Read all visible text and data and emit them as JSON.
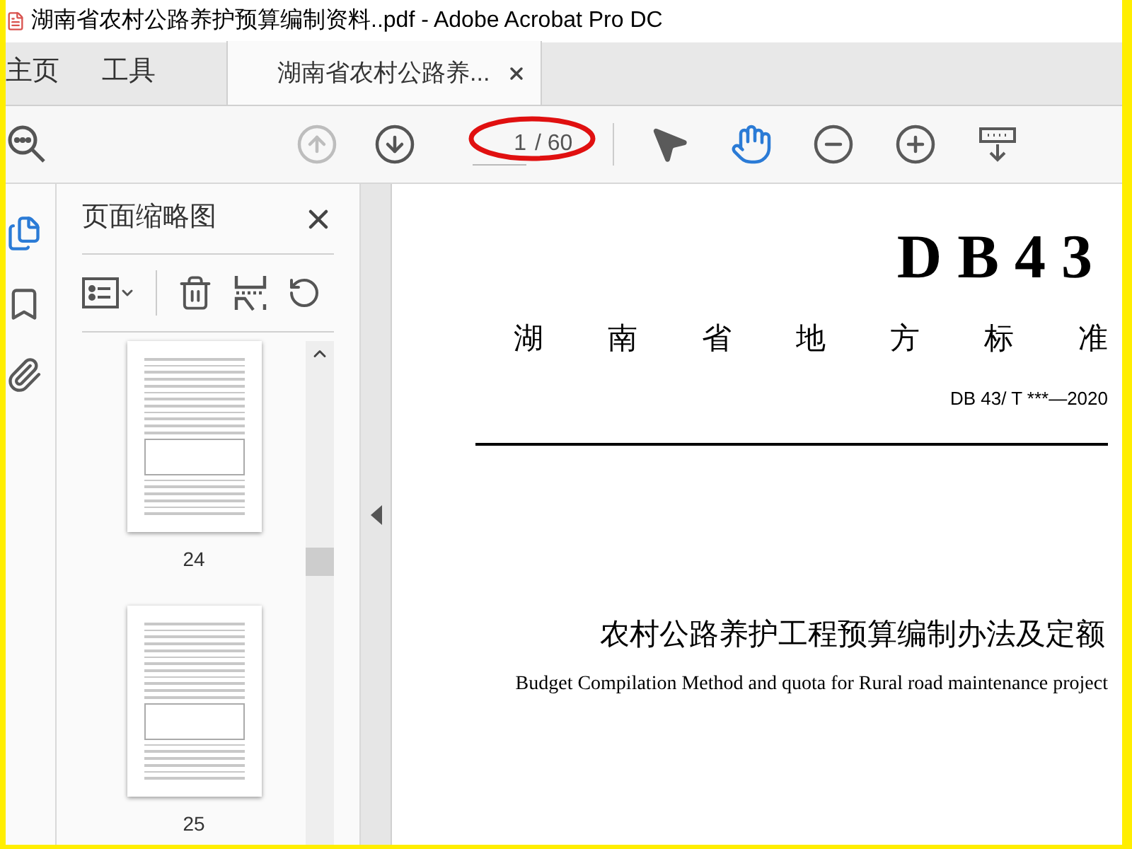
{
  "window": {
    "title": "湖南省农村公路养护预算编制资料..pdf - Adobe Acrobat Pro DC"
  },
  "tabs": [
    {
      "label": "主页",
      "selected": false
    },
    {
      "label": "工具",
      "selected": false
    },
    {
      "label": "湖南省农村公路养...",
      "selected": true
    }
  ],
  "toolbar": {
    "page_up": {
      "disabled": true
    },
    "page_down": {
      "disabled": false
    },
    "page_input": "1",
    "page_total": "/ 60",
    "tools": [
      {
        "kind": "select",
        "selected": false
      },
      {
        "kind": "hand",
        "selected": true
      },
      {
        "kind": "zoom-out",
        "selected": false
      },
      {
        "kind": "zoom-in",
        "selected": false
      },
      {
        "kind": "download",
        "selected": false
      }
    ]
  },
  "rail": [
    {
      "kind": "pages",
      "selected": true
    },
    {
      "kind": "bookmark",
      "selected": false
    },
    {
      "kind": "attachment",
      "selected": false
    }
  ],
  "panel": {
    "title": "页面缩略图",
    "thumbnails": [
      {
        "label": "24"
      },
      {
        "label": "25"
      }
    ]
  },
  "document": {
    "code": "DB43",
    "standard_type": "湖南省地方标准",
    "number": "DB 43/ T ***—2020",
    "title": "农村公路养护工程预算编制办法及定额",
    "subtitle": "Budget Compilation Method and quota for Rural road maintenance project"
  }
}
